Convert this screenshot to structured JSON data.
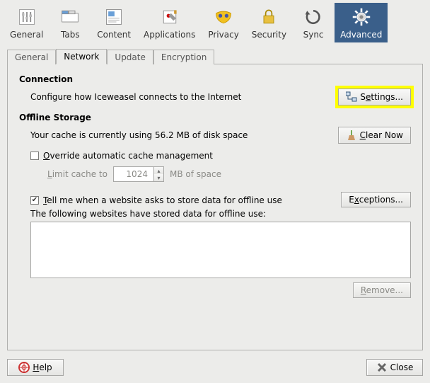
{
  "categories": {
    "general": "General",
    "tabs": "Tabs",
    "content": "Content",
    "applications": "Applications",
    "privacy": "Privacy",
    "security": "Security",
    "sync": "Sync",
    "advanced": "Advanced"
  },
  "subtabs": {
    "general": "General",
    "network": "Network",
    "update": "Update",
    "encryption": "Encryption"
  },
  "connection": {
    "title": "Connection",
    "desc": "Configure how Iceweasel connects to the Internet",
    "settings_btn": "Settings..."
  },
  "offline": {
    "title": "Offline Storage",
    "cache_status": "Your cache is currently using 56.2 MB of disk space",
    "clear_btn": "Clear Now",
    "override_label": "Override automatic cache management",
    "limit_label": "Limit cache to",
    "limit_value": "1024",
    "limit_units": "MB of space",
    "tell_me_label": "Tell me when a website asks to store data for offline use",
    "exceptions_btn": "Exceptions...",
    "stored_label": "The following websites have stored data for offline use:",
    "remove_btn": "Remove..."
  },
  "footer": {
    "help": "Help",
    "close": "Close"
  }
}
